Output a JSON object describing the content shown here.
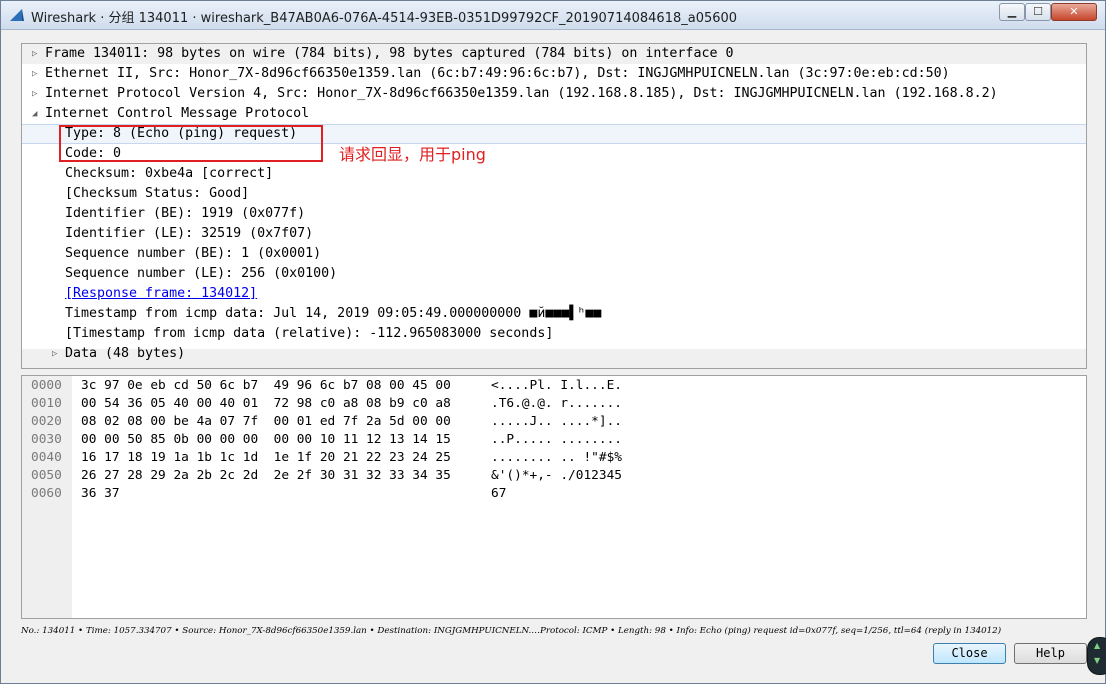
{
  "window": {
    "title": "Wireshark · 分组 134011 · wireshark_B47AB0A6-076A-4514-93EB-0351D99792CF_20190714084618_a05600",
    "min_glyph": "▁",
    "max_glyph": "☐",
    "close_glyph": "✕"
  },
  "tree": [
    {
      "name": "tree-frame",
      "arrow": "▷",
      "indent": 0,
      "text": "Frame 134011: 98 bytes on wire (784 bits), 98 bytes captured (784 bits) on interface 0"
    },
    {
      "name": "tree-ethernet",
      "arrow": "▷",
      "indent": 0,
      "text": "Ethernet II, Src: Honor_7X-8d96cf66350e1359.lan (6c:b7:49:96:6c:b7), Dst: INGJGMHPUICNELN.lan (3c:97:0e:eb:cd:50)"
    },
    {
      "name": "tree-ipv4",
      "arrow": "▷",
      "indent": 0,
      "text": "Internet Protocol Version 4, Src: Honor_7X-8d96cf66350e1359.lan (192.168.8.185), Dst: INGJGMHPUICNELN.lan (192.168.8.2)"
    },
    {
      "name": "tree-icmp",
      "arrow": "◢",
      "indent": 0,
      "text": "Internet Control Message Protocol"
    },
    {
      "name": "field-type",
      "arrow": "",
      "indent": 1,
      "text": "Type: 8 (Echo (ping) request)",
      "selected": true
    },
    {
      "name": "field-code",
      "arrow": "",
      "indent": 1,
      "text": "Code: 0"
    },
    {
      "name": "field-checksum",
      "arrow": "",
      "indent": 1,
      "text": "Checksum: 0xbe4a [correct]"
    },
    {
      "name": "field-checksum-status",
      "arrow": "",
      "indent": 1,
      "text": "[Checksum Status: Good]"
    },
    {
      "name": "field-identifier-be",
      "arrow": "",
      "indent": 1,
      "text": "Identifier (BE): 1919 (0x077f)"
    },
    {
      "name": "field-identifier-le",
      "arrow": "",
      "indent": 1,
      "text": "Identifier (LE): 32519 (0x7f07)"
    },
    {
      "name": "field-seq-be",
      "arrow": "",
      "indent": 1,
      "text": "Sequence number (BE): 1 (0x0001)"
    },
    {
      "name": "field-seq-le",
      "arrow": "",
      "indent": 1,
      "text": "Sequence number (LE): 256 (0x0100)"
    },
    {
      "name": "field-response-frame",
      "arrow": "",
      "indent": 1,
      "text": "[Response frame: 134012]",
      "link": true
    },
    {
      "name": "field-timestamp",
      "arrow": "",
      "indent": 1,
      "text": "Timestamp from icmp data: Jul 14, 2019 09:05:49.000000000 ■й■■■▌ʰ■■"
    },
    {
      "name": "field-timestamp-relative",
      "arrow": "",
      "indent": 1,
      "text": "[Timestamp from icmp data (relative): -112.965083000 seconds]"
    },
    {
      "name": "tree-data",
      "arrow": "▷",
      "indent": 1,
      "text": "Data (48 bytes)"
    }
  ],
  "annotation": "请求回显，用于ping",
  "hexdump": [
    {
      "off": "0000",
      "hex": "3c 97 0e eb cd 50 6c b7  49 96 6c b7 08 00 45 00",
      "ascii": "<....Pl. I.l...E."
    },
    {
      "off": "0010",
      "hex": "00 54 36 05 40 00 40 01  72 98 c0 a8 08 b9 c0 a8",
      "ascii": ".T6.@.@. r......."
    },
    {
      "off": "0020",
      "hex": "08 02 08 00 be 4a 07 7f  00 01 ed 7f 2a 5d 00 00",
      "ascii": ".....J.. ....*].."
    },
    {
      "off": "0030",
      "hex": "00 00 50 85 0b 00 00 00  00 00 10 11 12 13 14 15",
      "ascii": "..P..... ........"
    },
    {
      "off": "0040",
      "hex": "16 17 18 19 1a 1b 1c 1d  1e 1f 20 21 22 23 24 25",
      "ascii": "........ .. !\"#$%"
    },
    {
      "off": "0050",
      "hex": "26 27 28 29 2a 2b 2c 2d  2e 2f 30 31 32 33 34 35",
      "ascii": "&'()*+,- ./012345"
    },
    {
      "off": "0060",
      "hex": "36 37",
      "ascii": "67"
    }
  ],
  "status": "No.: 134011 • Time: 1057.334707 • Source: Honor_7X-8d96cf66350e1359.lan • Destination: INGJGMHPUICNELN.…Protocol: ICMP • Length: 98 • Info: Echo (ping) request id=0x077f, seq=1/256, ttl=64 (reply in 134012)",
  "buttons": {
    "close": "Close",
    "help": "Help"
  },
  "gadget": {
    "up": "▲",
    "down": "▼"
  },
  "colors": {
    "annotation": "#e02020",
    "link": "#0000ee",
    "selected_row": "#f0f5fc"
  }
}
